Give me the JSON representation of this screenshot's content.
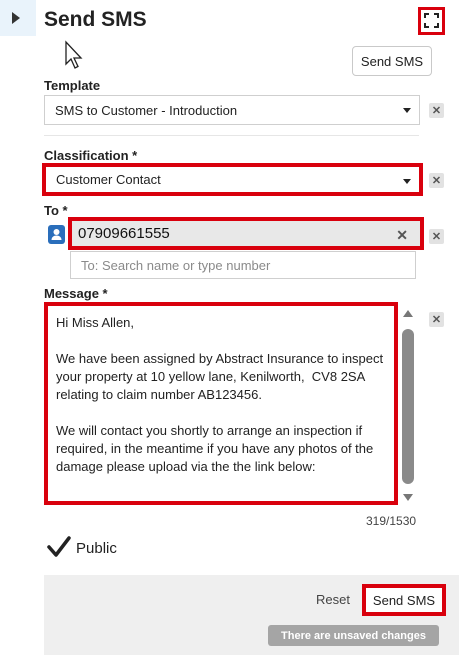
{
  "header": {
    "title": "Send SMS",
    "send_button": "Send SMS",
    "collapse_icon": "caret-right-icon",
    "expand_icon": "expand-icon"
  },
  "template": {
    "label": "Template",
    "value": "SMS to Customer - Introduction"
  },
  "classification": {
    "label": "Classification *",
    "value": "Customer Contact"
  },
  "to": {
    "label": "To *",
    "chip_value": "07909661555",
    "placeholder": "To: Search name or type number"
  },
  "message": {
    "label": "Message *",
    "text": "Hi Miss Allen,\n\nWe have been assigned by Abstract Insurance to inspect your property at 10 yellow lane, Kenilworth,  CV8 2SA relating to claim number AB123456.\n\nWe will contact you shortly to arrange an inspection if required, in the meantime if you have any photos of the damage please upload via the the link below:",
    "counter": "319/1530"
  },
  "public": {
    "label": "Public",
    "checked": true
  },
  "footer": {
    "reset_label": "Reset",
    "send_label": "Send SMS",
    "unsaved_notice": "There are unsaved changes"
  },
  "colors": {
    "highlight": "#d9000d",
    "contact_icon": "#2a6ebb",
    "footer_bg": "#efefef"
  }
}
